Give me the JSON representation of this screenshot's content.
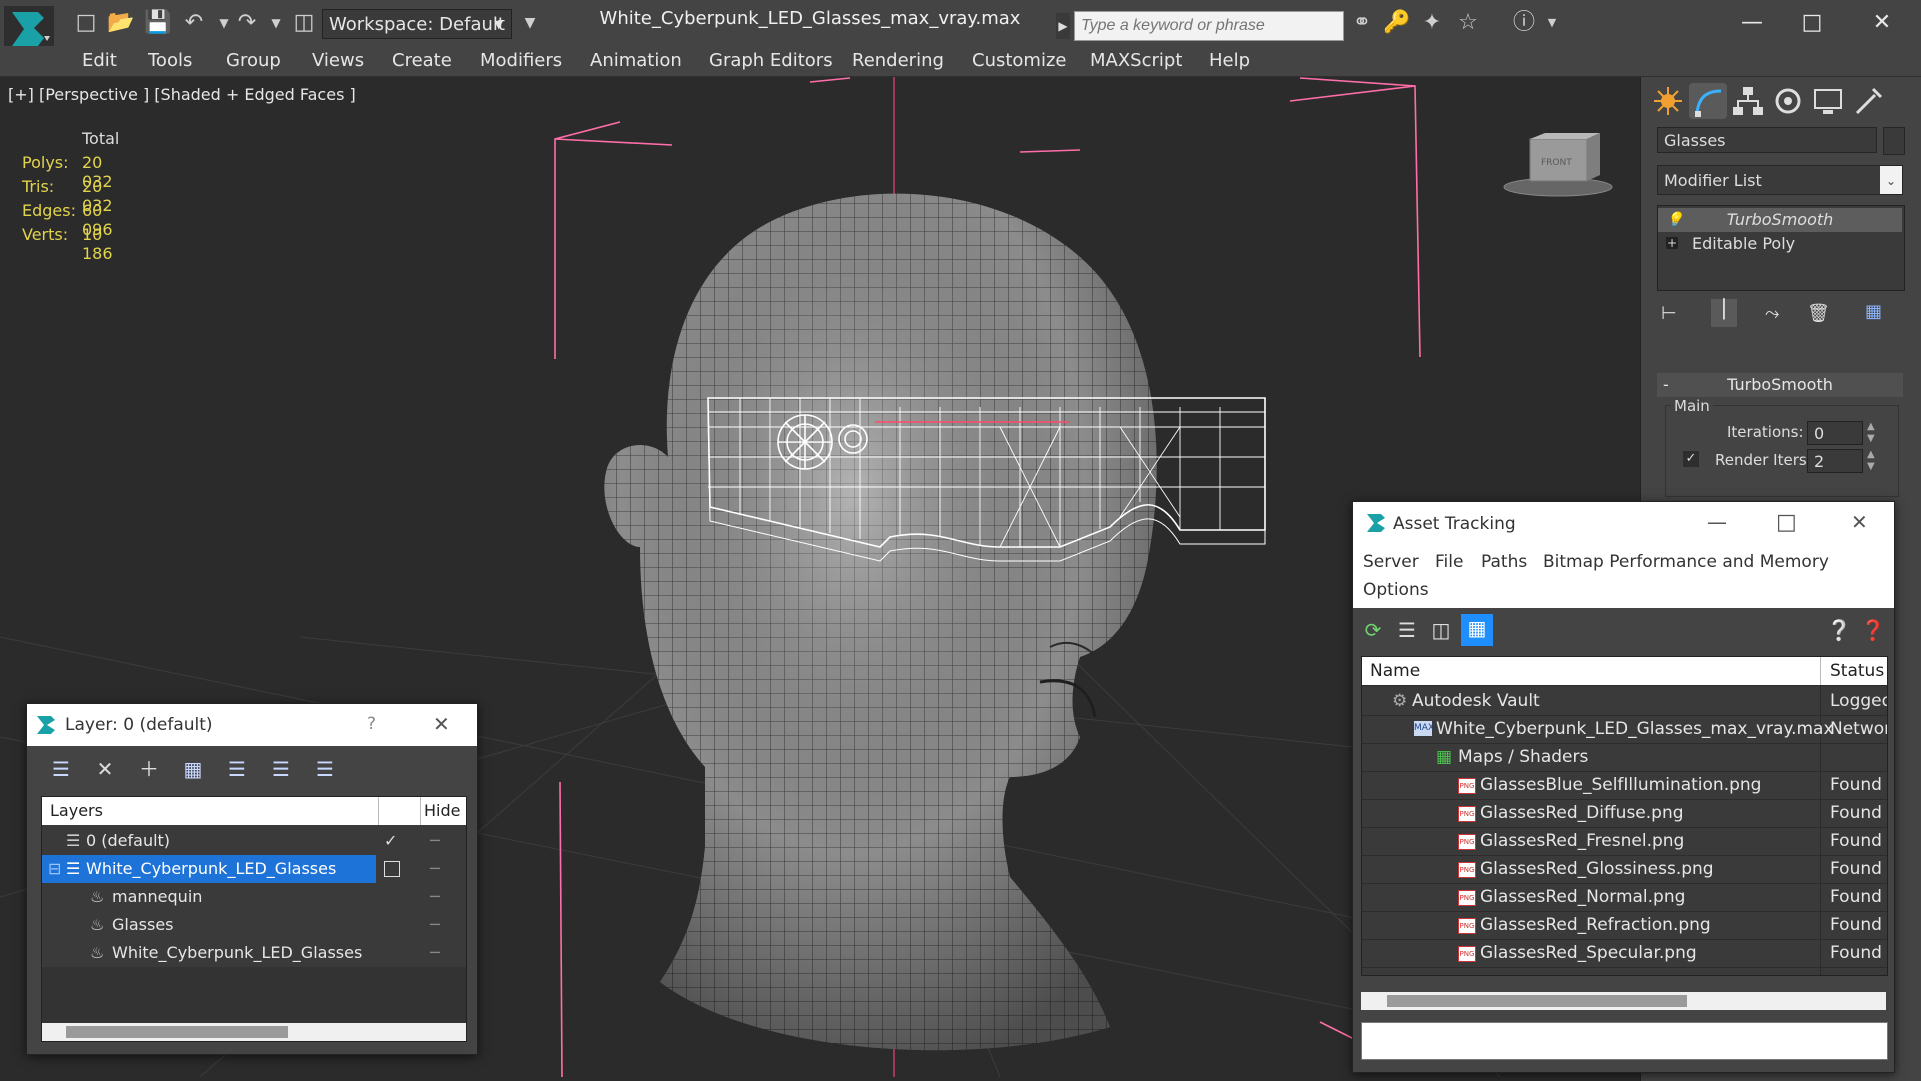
{
  "titlebar": {
    "workspace": "Workspace: Default",
    "file_title": "White_Cyberpunk_LED_Glasses_max_vray.max",
    "search_placeholder": "Type a keyword or phrase"
  },
  "menu": [
    "Edit",
    "Tools",
    "Group",
    "Views",
    "Create",
    "Modifiers",
    "Animation",
    "Graph Editors",
    "Rendering",
    "Customize",
    "MAXScript",
    "Help"
  ],
  "viewport": {
    "label": "[+] [Perspective ] [Shaded + Edged Faces ]",
    "stats_header": "Total",
    "stats": [
      {
        "k": "Polys:",
        "v": "20 032"
      },
      {
        "k": "Tris:",
        "v": "20 032"
      },
      {
        "k": "Edges:",
        "v": "60 096"
      },
      {
        "k": "Verts:",
        "v": "10 186"
      }
    ],
    "viewcube_label": "FRONT"
  },
  "command_panel": {
    "object_name": "Glasses",
    "modifier_list": "Modifier List",
    "stack": [
      "TurboSmooth",
      "Editable Poly"
    ],
    "rollout_title": "TurboSmooth",
    "group_label": "Main",
    "iterations_label": "Iterations:",
    "iterations_value": "0",
    "render_iters_label": "Render Iters:",
    "render_iters_value": "2"
  },
  "asset_tracking": {
    "title": "Asset Tracking",
    "menu": [
      "Server",
      "File",
      "Paths",
      "Bitmap Performance and Memory",
      "Options"
    ],
    "col_name": "Name",
    "col_status": "Status",
    "rows": [
      {
        "name": "Autodesk Vault",
        "status": "Logged",
        "indent": 1
      },
      {
        "name": "White_Cyberpunk_LED_Glasses_max_vray.max",
        "status": "Network",
        "indent": 2
      },
      {
        "name": "Maps / Shaders",
        "status": "",
        "indent": 3
      },
      {
        "name": "GlassesBlue_SelfIllumination.png",
        "status": "Found",
        "indent": 4
      },
      {
        "name": "GlassesRed_Diffuse.png",
        "status": "Found",
        "indent": 4
      },
      {
        "name": "GlassesRed_Fresnel.png",
        "status": "Found",
        "indent": 4
      },
      {
        "name": "GlassesRed_Glossiness.png",
        "status": "Found",
        "indent": 4
      },
      {
        "name": "GlassesRed_Normal.png",
        "status": "Found",
        "indent": 4
      },
      {
        "name": "GlassesRed_Refraction.png",
        "status": "Found",
        "indent": 4
      },
      {
        "name": "GlassesRed_Specular.png",
        "status": "Found",
        "indent": 4
      }
    ]
  },
  "layers": {
    "title": "Layer: 0 (default)",
    "help": "?",
    "col_layers": "Layers",
    "col_hide": "Hide",
    "rows": [
      {
        "name": "0 (default)",
        "indent": 1
      },
      {
        "name": "White_Cyberpunk_LED_Glasses",
        "indent": 1
      },
      {
        "name": "mannequin",
        "indent": 2
      },
      {
        "name": "Glasses",
        "indent": 2
      },
      {
        "name": "White_Cyberpunk_LED_Glasses",
        "indent": 2
      }
    ]
  },
  "colors": {
    "accent": "#1f8fff",
    "stats": "#e2d44c",
    "selection": "#1e73d8",
    "bounding_box": "#ff6ea8"
  }
}
